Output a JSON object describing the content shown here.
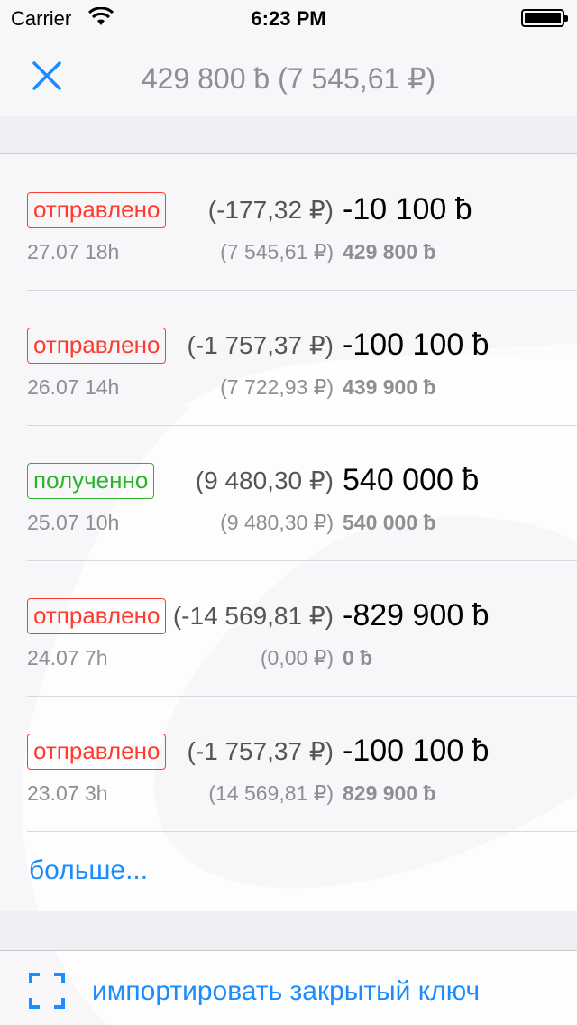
{
  "status_bar": {
    "carrier": "Carrier",
    "time": "6:23 PM"
  },
  "nav": {
    "title": "429 800 ƀ (7 545,61 ₽)",
    "close_icon": "close-icon"
  },
  "transactions": [
    {
      "status": "отправлено",
      "type": "sent",
      "fiat": "(-177,32 ₽)",
      "amount": "-10 100 ƀ",
      "date": "27.07 18h",
      "balance_fiat": "(7 545,61 ₽)",
      "balance_amount": "429 800 ƀ"
    },
    {
      "status": "отправлено",
      "type": "sent",
      "fiat": "(-1 757,37 ₽)",
      "amount": "-100 100 ƀ",
      "date": "26.07 14h",
      "balance_fiat": "(7 722,93 ₽)",
      "balance_amount": "439 900 ƀ"
    },
    {
      "status": "полученно",
      "type": "recv",
      "fiat": "(9 480,30 ₽)",
      "amount": "540 000 ƀ",
      "date": "25.07 10h",
      "balance_fiat": "(9 480,30 ₽)",
      "balance_amount": "540 000 ƀ"
    },
    {
      "status": "отправлено",
      "type": "sent",
      "fiat": "(-14 569,81 ₽)",
      "amount": "-829 900 ƀ",
      "date": "24.07 7h",
      "balance_fiat": "(0,00 ₽)",
      "balance_amount": "0 ƀ"
    },
    {
      "status": "отправлено",
      "type": "sent",
      "fiat": "(-1 757,37 ₽)",
      "amount": "-100 100 ƀ",
      "date": "23.07 3h",
      "balance_fiat": "(14 569,81 ₽)",
      "balance_amount": "829 900 ƀ"
    }
  ],
  "more_link": "больше...",
  "import": {
    "label": "импортировать закрытый ключ",
    "icon": "scan-icon"
  },
  "colors": {
    "accent": "#1a8cff",
    "sent": "#ff3b30",
    "received": "#2bb32b",
    "secondary_text": "#8e8e93"
  }
}
